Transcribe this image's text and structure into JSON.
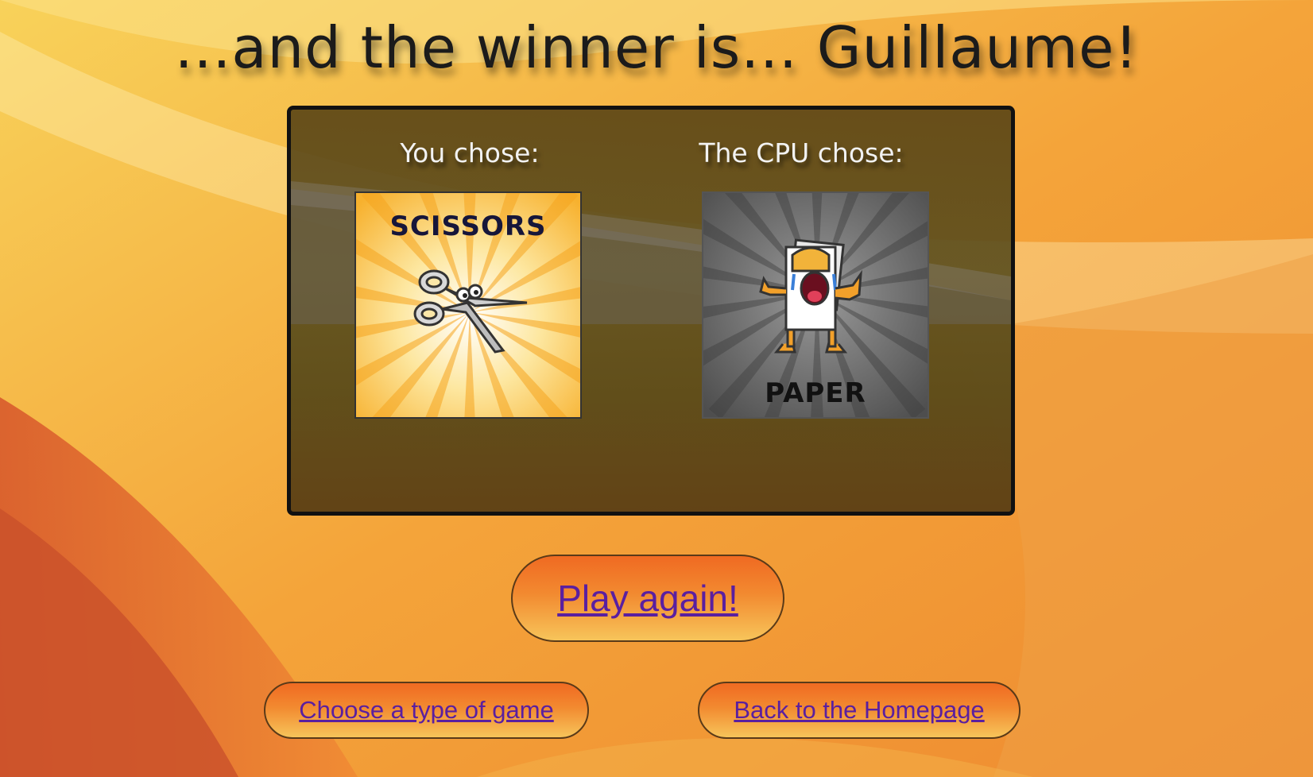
{
  "headline": "...and the winner is... Guillaume!",
  "result_panel": {
    "you_label": "You chose:",
    "cpu_label": "The CPU chose:",
    "player_choice": {
      "name": "SCISSORS",
      "icon": "scissors-icon"
    },
    "cpu_choice": {
      "name": "PAPER",
      "icon": "paper-character-icon"
    }
  },
  "actions": {
    "play_again": "Play again!",
    "choose_game": "Choose a type of game",
    "homepage": "Back to the Homepage"
  },
  "colors": {
    "panel_bg": "#5c4616",
    "button_orange": "#f28a30",
    "link_purple": "#5a1fa0",
    "scissors_card_bg": "#f9c23c",
    "paper_card_bg": "#5a5a5a"
  }
}
